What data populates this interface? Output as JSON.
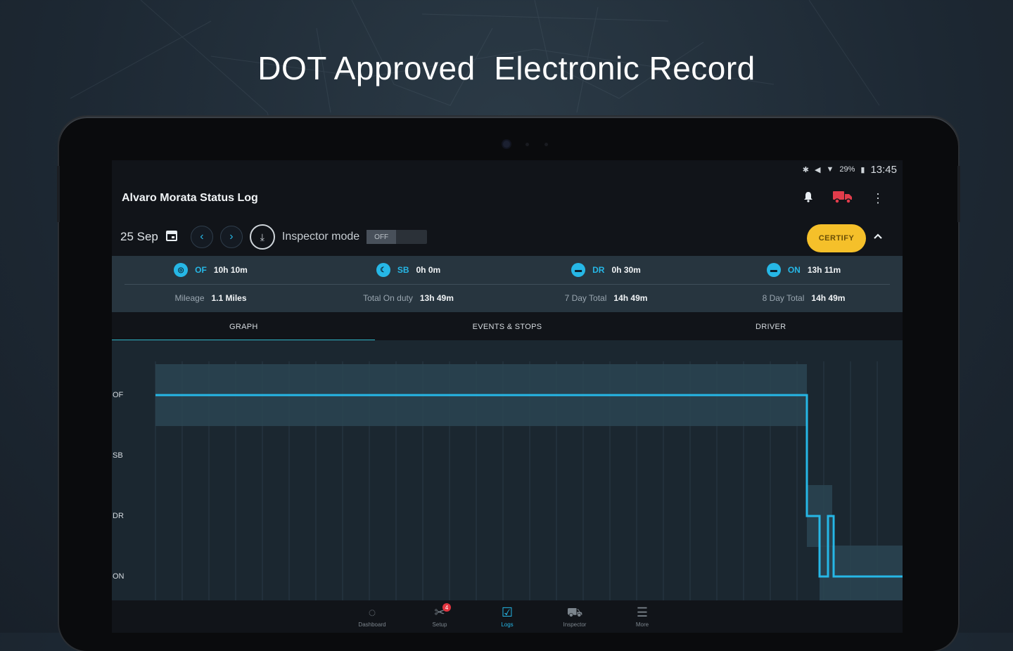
{
  "headline": "DOT Approved  Electronic Record",
  "statusbar": {
    "battery": "29%",
    "time": "13:45"
  },
  "appbar": {
    "title": "Alvaro Morata Status Log",
    "icons": [
      "bell-icon",
      "truck-icon",
      "more-vert-icon"
    ],
    "truck_color": "#e23c4b"
  },
  "toolbar": {
    "date": "25 Sep",
    "inspector_label": "Inspector mode",
    "inspector_state": "OFF",
    "certify_label": "CERTIFY",
    "certify_color": "#f5c02a"
  },
  "summary": {
    "statuses": [
      {
        "code": "OF",
        "value": "10h 10m"
      },
      {
        "code": "SB",
        "value": "0h 0m"
      },
      {
        "code": "DR",
        "value": "0h 30m"
      },
      {
        "code": "ON",
        "value": "13h 11m"
      }
    ],
    "totals": [
      {
        "label": "Mileage",
        "value": "1.1 Miles"
      },
      {
        "label": "Total On duty",
        "value": "13h 49m"
      },
      {
        "label": "7 Day Total",
        "value": "14h 49m"
      },
      {
        "label": "8 Day Total",
        "value": "14h 49m"
      }
    ],
    "accent": "#26b7e6"
  },
  "tabs": [
    {
      "label": "GRAPH",
      "active": true
    },
    {
      "label": "EVENTS & STOPS",
      "active": false
    },
    {
      "label": "DRIVER",
      "active": false
    }
  ],
  "graph": {
    "rows": [
      "OF",
      "SB",
      "DR",
      "ON"
    ],
    "line_color": "#26b7e6"
  },
  "bottom_nav": [
    {
      "label": "Dashboard",
      "icon": "dashboard-icon",
      "active": false
    },
    {
      "label": "Setup",
      "icon": "setup-icon",
      "active": false,
      "badge": "4"
    },
    {
      "label": "Logs",
      "icon": "logs-icon",
      "active": true
    },
    {
      "label": "Inspector",
      "icon": "inspector-icon",
      "active": false
    },
    {
      "label": "More",
      "icon": "menu-icon",
      "active": false
    }
  ]
}
